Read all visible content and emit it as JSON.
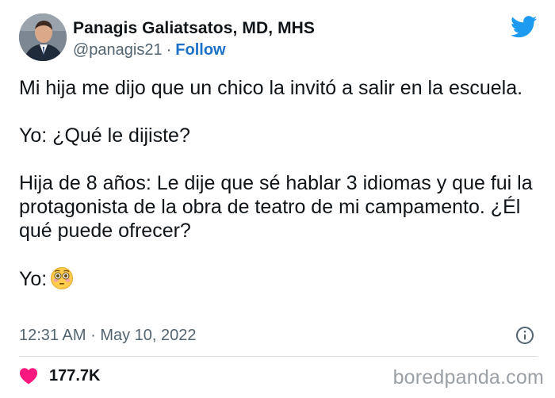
{
  "author": {
    "name": "Panagis Galiatsatos, MD, MHS",
    "handle": "@panagis21",
    "separator": "·",
    "follow_label": "Follow"
  },
  "logo_icon": "twitter-bird-icon",
  "tweet": {
    "paragraph_1": "Mi hija me dijo que un chico la invitó a salir en la escuela.",
    "paragraph_2": "Yo: ¿Qué le dijiste?",
    "paragraph_3": "Hija de 8 años: Le dije que sé hablar 3 idiomas y que fui la protagonista de la obra de teatro de mi campamento. ¿Él qué puede ofrecer?",
    "paragraph_4": "Yo:",
    "emoji_icon": "flushed-face-emoji"
  },
  "meta": {
    "time": "12:31 AM",
    "separator": "·",
    "date": "May 10, 2022",
    "info_icon": "info-icon"
  },
  "engagement": {
    "like_icon": "heart-icon",
    "like_count": "177.7K"
  },
  "watermark": "boredpanda.com",
  "colors": {
    "text": "#0f1419",
    "muted": "#536471",
    "link": "#1d72c7",
    "twitter_blue": "#1d9bf0",
    "heart": "#f91880",
    "divider": "#dbe1e5",
    "watermark": "#9aa0a6"
  }
}
